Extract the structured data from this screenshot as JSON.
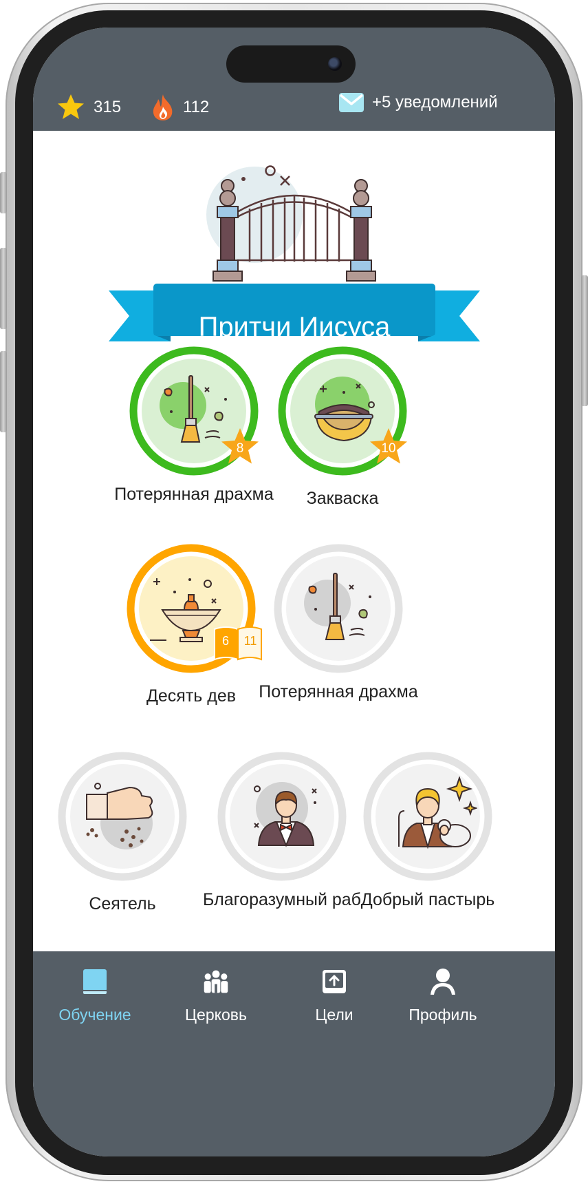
{
  "status": {
    "stars": "315",
    "streak": "112",
    "notifications": "+5 уведомлений"
  },
  "header": {
    "title": "Притчи Иисуса"
  },
  "lessons": [
    {
      "title": "Потерянная драхма",
      "state": "completed",
      "stars": "8",
      "icon": "broom-icon"
    },
    {
      "title": "Закваска",
      "state": "completed",
      "stars": "10",
      "icon": "dough-bowl-icon"
    },
    {
      "title": "Десять дев",
      "state": "in-progress",
      "progress_current": "6",
      "progress_total": "11",
      "icon": "oil-lamp-icon"
    },
    {
      "title": "Потерянная драхма",
      "state": "locked",
      "icon": "broom-icon"
    },
    {
      "title": "Сеятель",
      "state": "locked",
      "icon": "sowing-hand-icon"
    },
    {
      "title": "Благоразумный раб",
      "state": "locked",
      "icon": "servant-icon"
    },
    {
      "title": "Добрый пастырь",
      "state": "locked",
      "icon": "shepherd-icon"
    }
  ],
  "nav": [
    {
      "label": "Обучение",
      "icon": "book-icon",
      "active": true
    },
    {
      "label": "Церковь",
      "icon": "people-icon",
      "active": false
    },
    {
      "label": "Цели",
      "icon": "goals-icon",
      "active": false
    },
    {
      "label": "Профиль",
      "icon": "profile-icon",
      "active": false
    }
  ],
  "colors": {
    "topbar": "#555e66",
    "completed_ring": "#3dba1e",
    "in_progress_ring": "#ffa500",
    "locked_ring": "#e3e3e3",
    "star_badge": "#f8a61a",
    "ribbon": "#109fd6",
    "nav_active": "#7fd4f2"
  }
}
